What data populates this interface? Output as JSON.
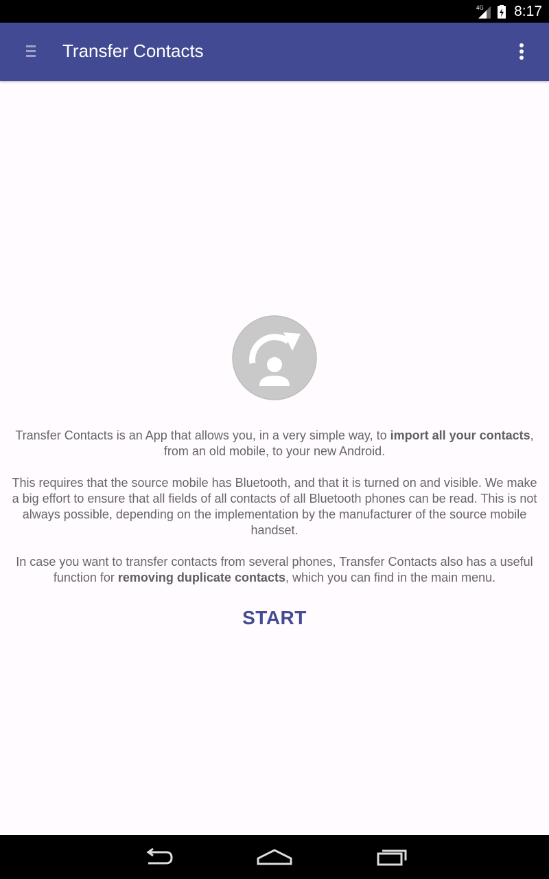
{
  "status_bar": {
    "network": "4G",
    "time": "8:17"
  },
  "app_bar": {
    "title": "Transfer Contacts",
    "menu_icon": "drawer-menu-icon",
    "overflow_icon": "more-vert-icon",
    "color": "#424a93"
  },
  "main": {
    "logo_icon": "contact-transfer-icon",
    "intro": {
      "before": "Transfer Contacts is an App that allows you, in a very simple way, to ",
      "bold": "import all your contacts",
      "after": ", from an old mobile, to your new Android."
    },
    "requirements": "This requires that the source mobile has Bluetooth, and that it is turned on and visible. We make a big effort to ensure that all fields of all contacts of all Bluetooth phones can be read. This is not always possible, depending on the implementation by the manufacturer of the source mobile handset.",
    "duplicates": {
      "before": "In case you want to transfer contacts from several phones, Transfer Contacts also has a useful function for ",
      "bold": "removing duplicate contacts",
      "after": ", which you can find in the main menu."
    },
    "start_label": "START"
  },
  "nav_bar": {
    "back_icon": "back-icon",
    "home_icon": "home-icon",
    "recents_icon": "recents-icon"
  }
}
